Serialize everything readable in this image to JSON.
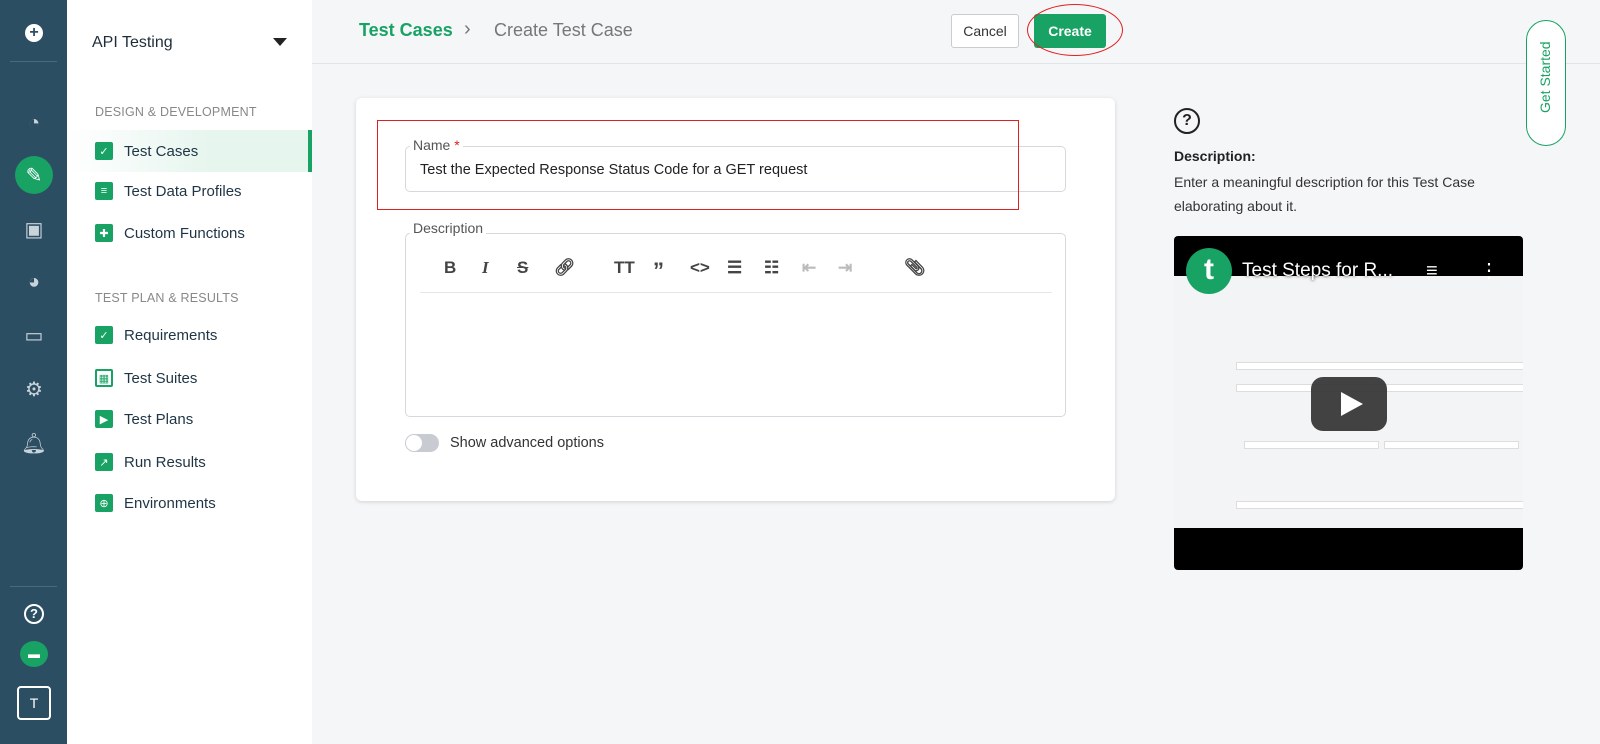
{
  "rail": {
    "items": [
      "add-icon",
      "dashboard-icon",
      "edit-icon",
      "briefcase-icon",
      "reports-icon",
      "monitor-icon",
      "settings-icon",
      "bell-icon",
      "help-icon",
      "chat-icon"
    ],
    "avatar": "T"
  },
  "sidebar": {
    "project": "API Testing",
    "sections": [
      {
        "title": "DESIGN & DEVELOPMENT",
        "items": [
          {
            "label": "Test Cases"
          },
          {
            "label": "Test Data Profiles"
          },
          {
            "label": "Custom Functions"
          }
        ]
      },
      {
        "title": "TEST PLAN & RESULTS",
        "items": [
          {
            "label": "Requirements"
          },
          {
            "label": "Test Suites"
          },
          {
            "label": "Test Plans"
          },
          {
            "label": "Run Results"
          },
          {
            "label": "Environments"
          }
        ]
      }
    ]
  },
  "header": {
    "breadcrumb_root": "Test Cases",
    "breadcrumb_sep": "›",
    "breadcrumb_current": "Create Test Case",
    "cancel": "Cancel",
    "create": "Create",
    "get_started": "Get Started"
  },
  "form": {
    "name_label": "Name",
    "required_mark": "*",
    "name_value": "Test the Expected Response Status Code for a GET request",
    "description_label": "Description",
    "advanced_label": "Show advanced options",
    "advanced_on": false
  },
  "help": {
    "title": "Description:",
    "text": "Enter a meaningful description for this Test Case elaborating about it."
  },
  "video": {
    "title": "Test Steps for R..."
  },
  "colors": {
    "accent": "#18a264",
    "rail": "#2c4e63",
    "highlight": "#e02020"
  }
}
